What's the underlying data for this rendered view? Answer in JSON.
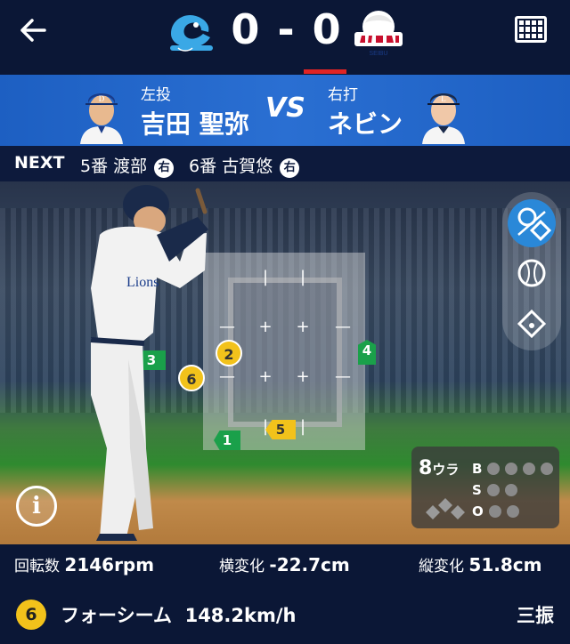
{
  "header": {
    "back_icon": "arrow-left-icon",
    "home_score": "0",
    "separator": "-",
    "away_score": "0",
    "menu_icon": "scoreboard-grid-icon",
    "accent_color": "#e02424"
  },
  "matchup": {
    "pitcher_role": "左投",
    "pitcher_name": "吉田 聖弥",
    "vs": "VS",
    "batter_role": "右打",
    "batter_name": "ネビン",
    "bg_color": "#2a6fd2"
  },
  "next": {
    "label": "NEXT",
    "batters": [
      {
        "order": "5番",
        "name": "渡部",
        "hand": "右"
      },
      {
        "order": "6番",
        "name": "古賀悠",
        "hand": "右"
      }
    ]
  },
  "field": {
    "pitches": [
      {
        "num": "1",
        "kind": "flag-green"
      },
      {
        "num": "2",
        "kind": "ball-yellow"
      },
      {
        "num": "3",
        "kind": "flag-green"
      },
      {
        "num": "4",
        "kind": "flag-green"
      },
      {
        "num": "5",
        "kind": "flag-yellow"
      },
      {
        "num": "6",
        "kind": "ball-yellow"
      }
    ],
    "tools": [
      "pitch-tracking-icon",
      "baseball-icon",
      "diamond-icon"
    ],
    "info_icon": "info-icon",
    "info_glyph": "i"
  },
  "count": {
    "inning": "8",
    "half": "ウラ",
    "labels": [
      "B",
      "S",
      "O"
    ],
    "balls": 0,
    "strikes": 0,
    "outs": 0
  },
  "stats": {
    "spin_label": "回転数",
    "spin_value": "2146rpm",
    "hbreak_label": "横変化",
    "hbreak_value": "-22.7cm",
    "vbreak_label": "縦変化",
    "vbreak_value": "51.8cm"
  },
  "pitch": {
    "number": "6",
    "type": "フォーシーム",
    "speed": "148.2km/h",
    "result": "三振"
  }
}
